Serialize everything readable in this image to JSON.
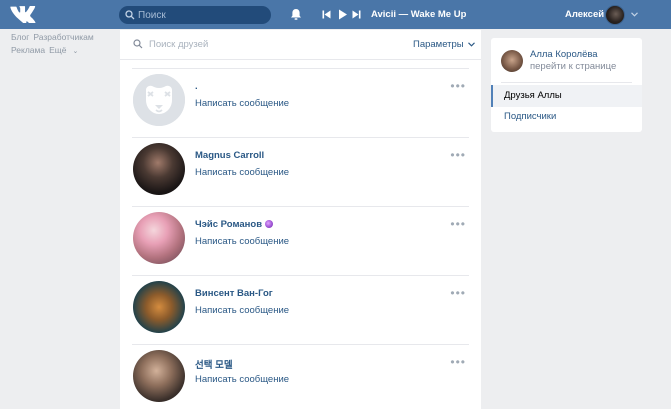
{
  "header": {
    "search_placeholder": "Поиск",
    "track": "Avicii — Wake Me Up",
    "username": "Алексей"
  },
  "left_nav": {
    "row1": [
      "Блог",
      "Разработчикам"
    ],
    "row2_more_label": "Ещё",
    "ads": "Реклама"
  },
  "friends": {
    "search_placeholder": "Поиск друзей",
    "params_label": "Параметры",
    "list": [
      {
        "name": ".",
        "message": "Написать сообщение"
      },
      {
        "name": "Magnus Carroll",
        "message": "Написать сообщение"
      },
      {
        "name": "Чэйс Романов",
        "message": "Написать сообщение"
      },
      {
        "name": "Винсент Ван-Гог",
        "message": "Написать сообщение"
      },
      {
        "name": "선택 모델",
        "message": "Написать сообщение"
      }
    ],
    "more_glyph": "•••"
  },
  "profile": {
    "name": "Алла Королёва",
    "link": "перейти к странице"
  },
  "menu": {
    "friends_label": "Друзья Аллы",
    "followers_label": "Подписчики"
  },
  "colors": {
    "header_bg": "#4a76a8",
    "page_bg": "#edeef0",
    "link": "#2a5885",
    "muted": "#828a99"
  }
}
